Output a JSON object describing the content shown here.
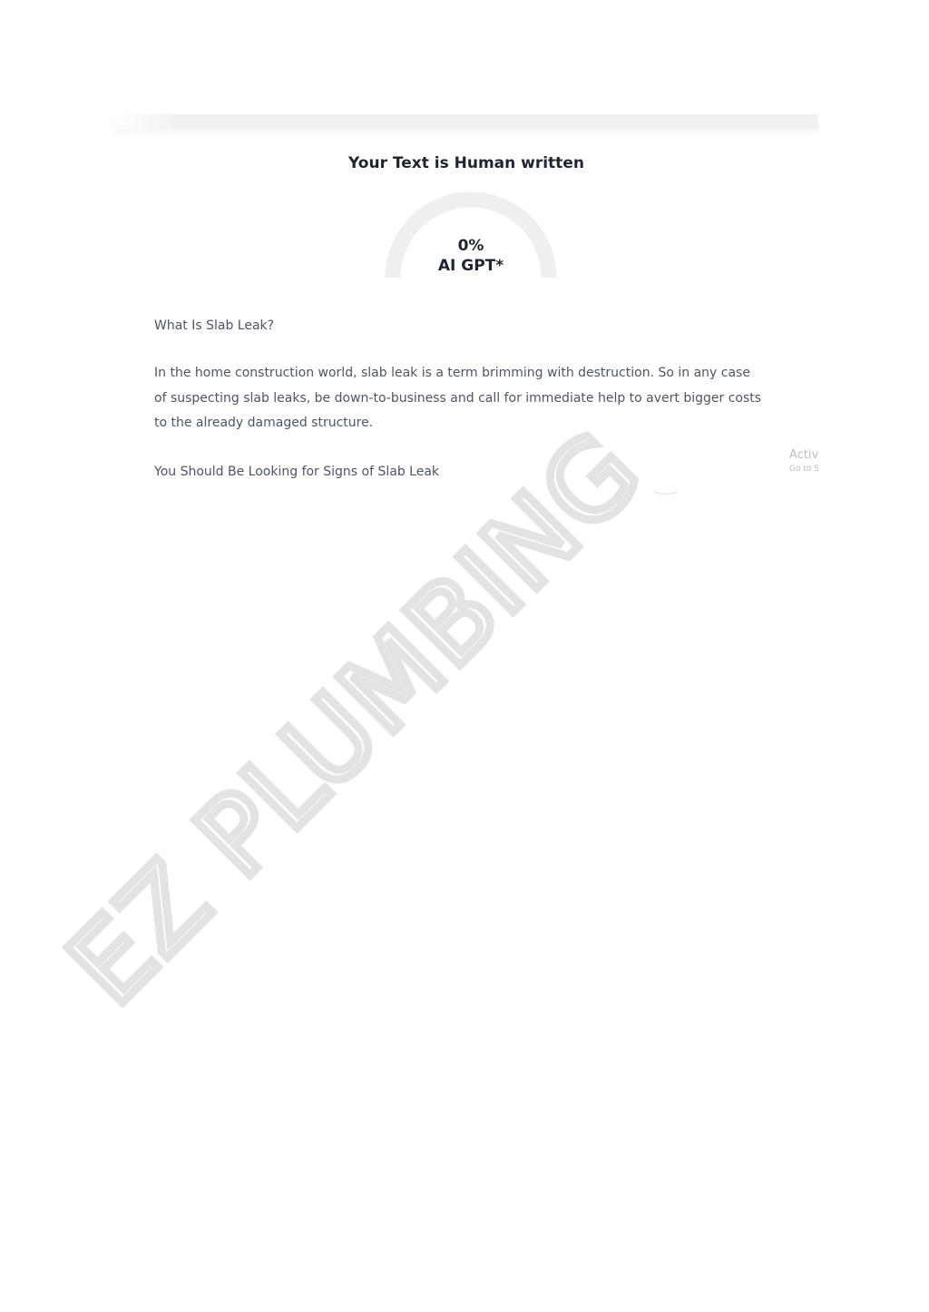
{
  "result": {
    "title": "Your Text is Human written",
    "gauge": {
      "percent_text": "0%",
      "label": "AI GPT*",
      "ai_fraction": 0
    }
  },
  "article": {
    "heading_1": "What Is Slab Leak?",
    "paragraph_1": "In the home construction world, slab leak is a term brimming with destruction. So in any case of suspecting slab leaks, be down-to-business and call for immediate help to avert bigger costs to the already damaged structure.",
    "heading_2": "You Should Be Looking for Signs of Slab Leak"
  },
  "os_overlay": {
    "line_1": "Activ",
    "line_2": "Go to S"
  },
  "watermark": {
    "text": "EZ PLUMBING"
  },
  "colors": {
    "gauge_track": "#efefef",
    "title_text": "#1f2430",
    "body_text": "#4d5566",
    "watermark": "#e3e3e3"
  }
}
